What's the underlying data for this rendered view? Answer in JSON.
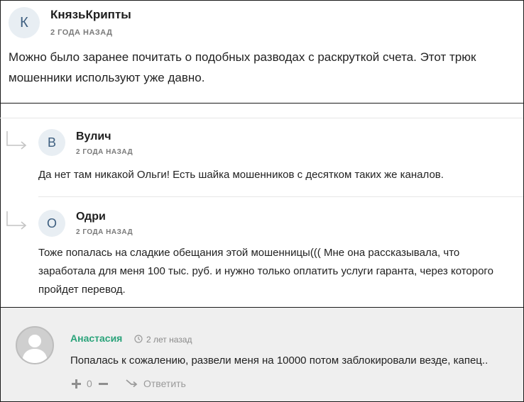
{
  "comments": [
    {
      "avatar_letter": "К",
      "author": "КнязьКрипты",
      "time": "2 ГОДА НАЗАД",
      "text_lines": [
        "Можно было заранее почитать о подобных разводах с раскруткой счета. Этот трюк",
        "мошенники используют уже давно."
      ]
    }
  ],
  "replies": [
    {
      "avatar_letter": "В",
      "author": "Вулич",
      "time": "2 ГОДА НАЗАД",
      "text_lines": [
        "Да нет там никакой Ольги! Есть шайка мошенников с десятком таких же каналов."
      ]
    },
    {
      "avatar_letter": "О",
      "author": "Одри",
      "time": "2 ГОДА НАЗАД",
      "text_lines": [
        "Тоже попалась на сладкие обещания этой мошенницы((( Мне она рассказывала, что",
        "заработала для меня 100 тыс. руб. и нужно только оплатить услуги гаранта, через которого",
        "пройдет перевод."
      ]
    }
  ],
  "guest_comment": {
    "author": "Анастасия",
    "time": "2 лет назад",
    "text": "Попалась к сожалению, развели меня на 10000 потом заблокировали везде, капец..",
    "vote_count": "0",
    "reply_label": "Ответить",
    "author_color": "#2aa37a"
  }
}
